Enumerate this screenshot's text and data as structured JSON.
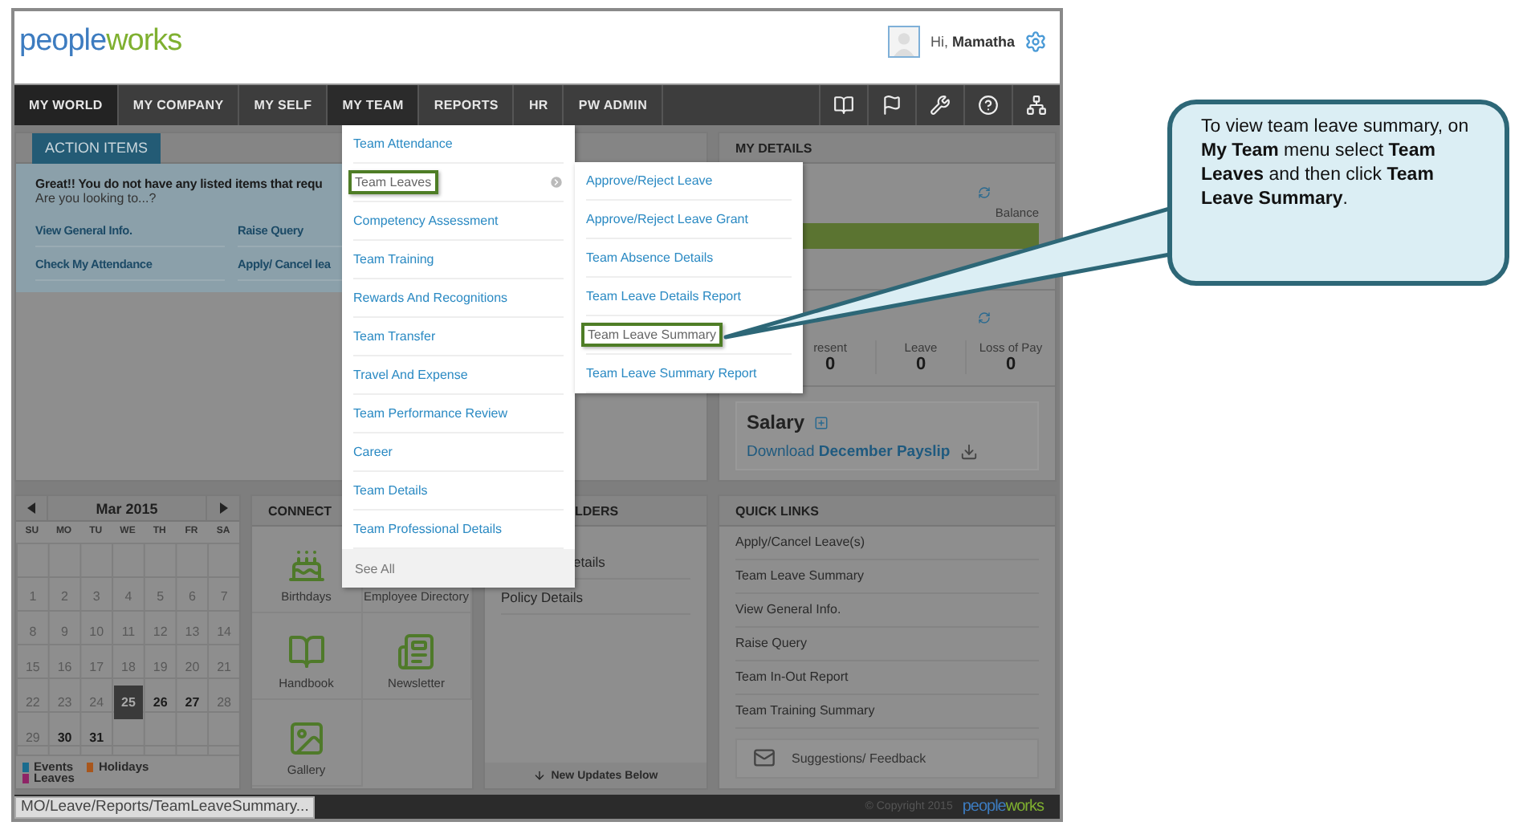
{
  "header": {
    "logo": [
      "people",
      "works"
    ],
    "greeting": "Hi, **Mamatha**"
  },
  "nav": {
    "tabs": [
      {
        "label": "MY WORLD",
        "selected": true,
        "open": false
      },
      {
        "label": "MY COMPANY",
        "selected": false,
        "open": false
      },
      {
        "label": "MY SELF",
        "selected": false,
        "open": false
      },
      {
        "label": "MY TEAM",
        "selected": false,
        "open": true
      },
      {
        "label": "REPORTS",
        "selected": false,
        "open": false
      },
      {
        "label": "HR",
        "selected": false,
        "open": false
      },
      {
        "label": "PW ADMIN",
        "selected": false,
        "open": false
      }
    ]
  },
  "action_items": {
    "tab": "ACTION ITEMS",
    "message": "Great!! You do not have any listed items that requ",
    "hint": "Are you looking to...?",
    "links": [
      "View General Info.",
      "Raise Query",
      "Check My Attendance",
      "Apply/ Cancel lea"
    ]
  },
  "my_details": {
    "title": "MY DETAILS",
    "balance_label": "Balance",
    "stats": [
      {
        "label": "resent",
        "value": "0"
      },
      {
        "label": "Leave",
        "value": "0"
      },
      {
        "label": "Loss of Pay",
        "value": "0"
      }
    ],
    "salary": {
      "title": "Salary",
      "download": "Download **December Payslip**"
    }
  },
  "calendar": {
    "month": "Mar 2015",
    "weekdays": [
      "SU",
      "MO",
      "TU",
      "WE",
      "TH",
      "FR",
      "SA"
    ],
    "weeks": [
      [
        {
          "kind": "empty"
        },
        {
          "kind": "empty"
        },
        {
          "kind": "empty"
        },
        {
          "kind": "empty"
        },
        {
          "kind": "empty"
        },
        {
          "kind": "empty"
        },
        {
          "kind": "empty"
        }
      ],
      [
        {
          "day": "1",
          "kind": "past"
        },
        {
          "day": "2",
          "kind": "past"
        },
        {
          "day": "3",
          "kind": "past"
        },
        {
          "day": "4",
          "kind": "past"
        },
        {
          "day": "5",
          "kind": "past"
        },
        {
          "day": "6",
          "kind": "past"
        },
        {
          "day": "7",
          "kind": "past"
        }
      ],
      [
        {
          "day": "8",
          "kind": "past"
        },
        {
          "day": "9",
          "kind": "past"
        },
        {
          "day": "10",
          "kind": "past"
        },
        {
          "day": "11",
          "kind": "past"
        },
        {
          "day": "12",
          "kind": "past"
        },
        {
          "day": "13",
          "kind": "past"
        },
        {
          "day": "14",
          "kind": "past"
        }
      ],
      [
        {
          "day": "15",
          "kind": "past"
        },
        {
          "day": "16",
          "kind": "past"
        },
        {
          "day": "17",
          "kind": "past"
        },
        {
          "day": "18",
          "kind": "past"
        },
        {
          "day": "19",
          "kind": "past"
        },
        {
          "day": "20",
          "kind": "past"
        },
        {
          "day": "21",
          "kind": "past"
        }
      ],
      [
        {
          "day": "22",
          "kind": "past"
        },
        {
          "day": "23",
          "kind": "past"
        },
        {
          "day": "24",
          "kind": "past"
        },
        {
          "day": "25",
          "kind": "today"
        },
        {
          "day": "26",
          "kind": "upcoming"
        },
        {
          "day": "27",
          "kind": "upcoming"
        },
        {
          "day": "28",
          "kind": "past"
        }
      ],
      [
        {
          "day": "29",
          "kind": "past"
        },
        {
          "day": "30",
          "kind": "upcoming"
        },
        {
          "day": "31",
          "kind": "upcoming"
        },
        {
          "kind": "empty"
        },
        {
          "kind": "empty"
        },
        {
          "kind": "empty"
        },
        {
          "kind": "empty"
        }
      ]
    ],
    "legend": [
      {
        "label": "Events",
        "color": "#1a6c8e"
      },
      {
        "label": "Leaves",
        "color": "#8e2466"
      },
      {
        "label": "Holidays",
        "color": "#a8561c"
      }
    ]
  },
  "connect": {
    "title": "CONNECT",
    "tiles": [
      {
        "label": "Birthdays",
        "kind": "cake"
      },
      {
        "label": "Employee Directory",
        "kind": "hidden"
      },
      {
        "label": "Handbook",
        "kind": "book"
      },
      {
        "label": "Newsletter",
        "kind": "news"
      },
      {
        "label": "Gallery",
        "kind": "gallery"
      }
    ]
  },
  "reminders": {
    "title": "LDERS",
    "items": [
      "etails",
      "Policy Details"
    ],
    "footer": "New Updates Below"
  },
  "quick_links": {
    "title": "QUICK LINKS",
    "links": [
      "Apply/Cancel Leave(s)",
      "Team Leave Summary",
      "View General Info.",
      "Raise Query",
      "Team In-Out Report",
      "Team Training Summary"
    ],
    "feedback": "Suggestions/ Feedback"
  },
  "footer": {
    "copyright": "© Copyright 2015",
    "logo": [
      "people",
      "works"
    ]
  },
  "status_url": "MO/Leave/Reports/TeamLeaveSummary...",
  "menu": {
    "items": [
      {
        "label": "Team Attendance",
        "selected": false,
        "submenu": false
      },
      {
        "label": "Team Leaves",
        "selected": true,
        "submenu": true
      },
      {
        "label": "Competency Assessment",
        "selected": false,
        "submenu": false
      },
      {
        "label": "Team Training",
        "selected": false,
        "submenu": false
      },
      {
        "label": "Rewards And Recognitions",
        "selected": false,
        "submenu": false
      },
      {
        "label": "Team Transfer",
        "selected": false,
        "submenu": false
      },
      {
        "label": "Travel And Expense",
        "selected": false,
        "submenu": false
      },
      {
        "label": "Team Performance Review",
        "selected": false,
        "submenu": false
      },
      {
        "label": "Career",
        "selected": false,
        "submenu": false
      },
      {
        "label": "Team Details",
        "selected": false,
        "submenu": false
      },
      {
        "label": "Team Professional Details",
        "selected": false,
        "submenu": false
      }
    ],
    "see_all": "See All"
  },
  "submenu": {
    "items": [
      {
        "label": "Approve/Reject Leave",
        "selected": false
      },
      {
        "label": "Approve/Reject Leave Grant",
        "selected": false
      },
      {
        "label": "Team Absence Details",
        "selected": false
      },
      {
        "label": "Team Leave Details Report",
        "selected": false
      },
      {
        "label": "Team Leave Summary",
        "selected": true
      },
      {
        "label": "Team Leave Summary Report",
        "selected": false
      }
    ]
  },
  "callout": {
    "text": "To view team leave summary, on **My Team** menu select **Team Leaves** and then click **Team Leave Summary**."
  }
}
